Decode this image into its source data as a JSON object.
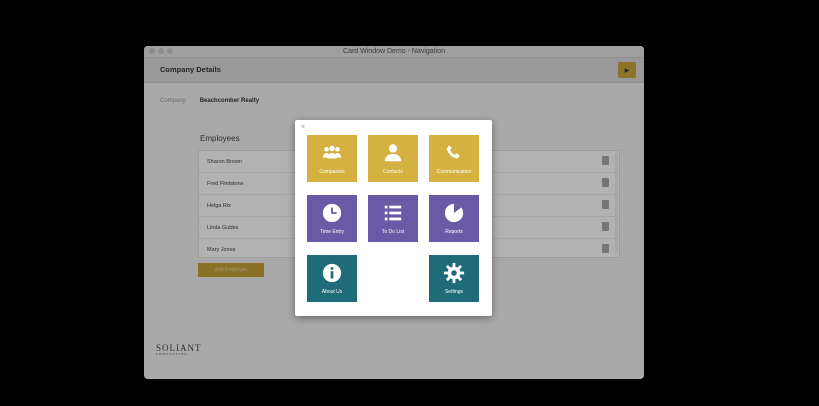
{
  "window": {
    "title": "Card Window Demo - Navigation"
  },
  "header": {
    "title": "Company Details"
  },
  "company": {
    "label": "Company",
    "value": "Beachcomber Realty"
  },
  "employees": {
    "title": "Employees",
    "rows": [
      "Sharon Brown",
      "Fred Flintstone",
      "Helga Rix",
      "Linda Gubbs",
      "Mary Jones"
    ],
    "add_label": "Add Employee"
  },
  "logo": {
    "name": "SOLIANT",
    "sub": "CONSULTING"
  },
  "nav": {
    "close": "×",
    "tiles": [
      {
        "label": "Companies",
        "icon": "people-icon",
        "color": "#d4b141"
      },
      {
        "label": "Contacts",
        "icon": "person-icon",
        "color": "#d4b141"
      },
      {
        "label": "Communication",
        "icon": "phone-icon",
        "color": "#d4b141"
      },
      {
        "label": "Time Entry",
        "icon": "clock-icon",
        "color": "#6a5aa6"
      },
      {
        "label": "To Do List",
        "icon": "list-icon",
        "color": "#6a5aa6"
      },
      {
        "label": "Reports",
        "icon": "pie-chart-icon",
        "color": "#6a5aa6"
      },
      {
        "label": "About Us",
        "icon": "info-icon",
        "color": "#1f6b7a"
      },
      {
        "label": "Settings",
        "icon": "gear-icon",
        "color": "#1f6b7a"
      }
    ]
  }
}
